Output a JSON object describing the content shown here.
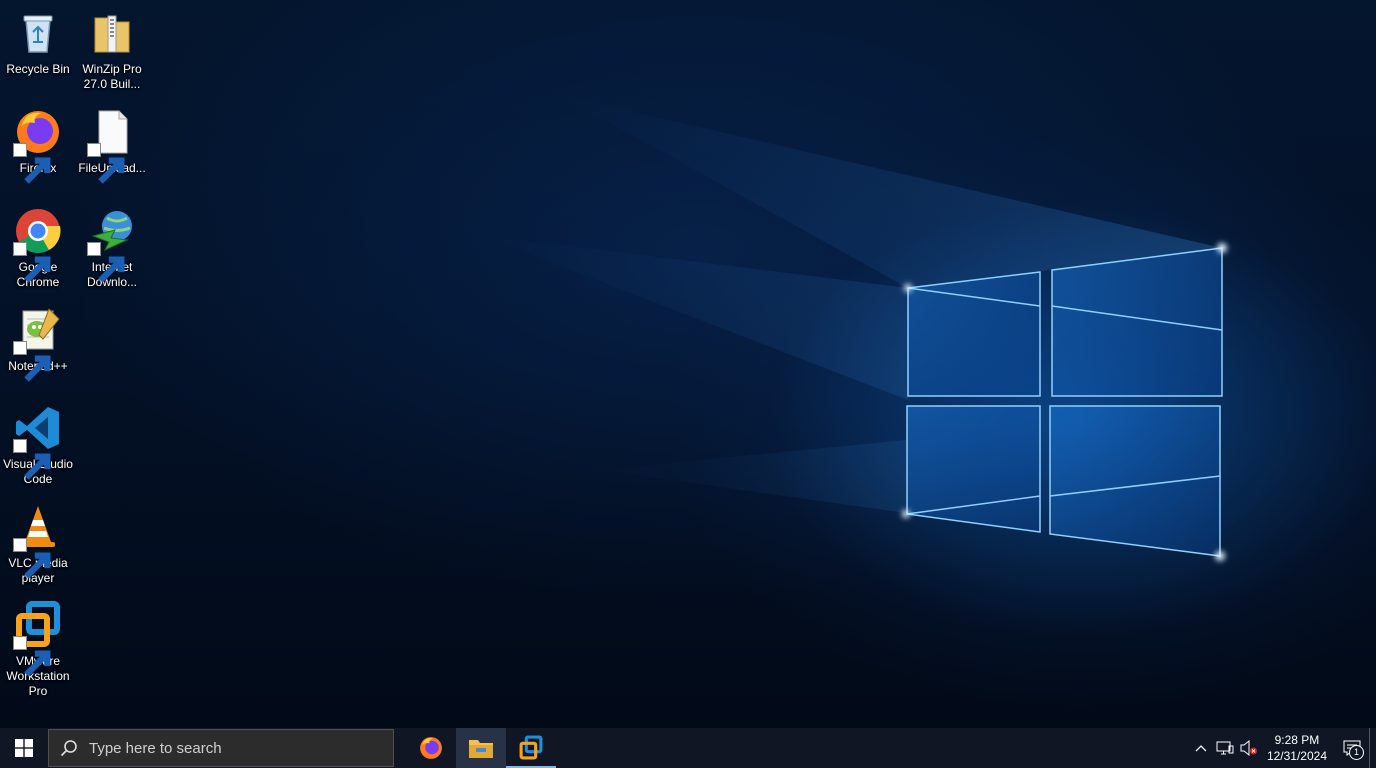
{
  "desktop": {
    "icons": [
      {
        "label": "Recycle Bin",
        "icon": "recycle-bin-icon"
      },
      {
        "label": "WinZip Pro 27.0 Buil...",
        "icon": "winzip-folder-icon"
      },
      {
        "label": "Firefox",
        "icon": "firefox-icon"
      },
      {
        "label": "FileUpload...",
        "icon": "blank-file-icon"
      },
      {
        "label": "Google Chrome",
        "icon": "chrome-icon"
      },
      {
        "label": "Internet Downlo...",
        "icon": "internet-download-manager-icon"
      },
      {
        "label": "Notepad++",
        "icon": "notepad-plus-plus-icon"
      },
      {
        "label": "Visual Studio Code",
        "icon": "vscode-icon"
      },
      {
        "label": "VLC media player",
        "icon": "vlc-icon"
      },
      {
        "label": "VMware Workstation Pro",
        "icon": "vmware-icon"
      }
    ]
  },
  "taskbar": {
    "search_placeholder": "Type here to search",
    "pinned": [
      {
        "name": "Firefox",
        "icon": "firefox-icon",
        "active": false
      },
      {
        "name": "File Explorer",
        "icon": "file-explorer-icon",
        "active": true
      },
      {
        "name": "VMware Workstation Pro",
        "icon": "vmware-icon",
        "active": false
      }
    ],
    "clock": {
      "time": "9:28 PM",
      "date": "12/31/2024"
    },
    "notification_count": "1"
  },
  "colors": {
    "taskbar_bg": "#101624",
    "accent": "#76b9ed",
    "wallpaper_blue": "#1f7fe0"
  }
}
